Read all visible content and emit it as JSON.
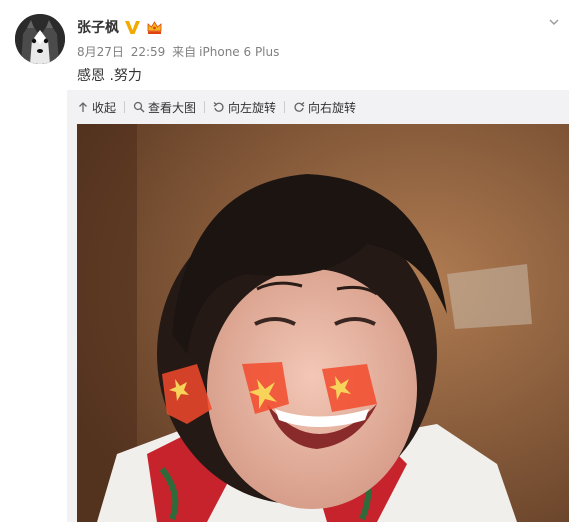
{
  "author": {
    "name": "张子枫"
  },
  "meta": {
    "date": "8月27日",
    "time": "22:59",
    "source_prefix": "来自",
    "source": "iPhone 6 Plus"
  },
  "post": {
    "text": "感恩 .努力"
  },
  "toolbar": {
    "collapse_label": "收起",
    "view_large_label": "查看大图",
    "rotate_left_label": "向左旋转",
    "rotate_right_label": "向右旋转"
  },
  "colors": {
    "accent_verified": "#f2a900",
    "member_badge": "#f6b622",
    "toolbar_icon": "#666666"
  },
  "icons": {
    "verified": "verified-v-icon",
    "member": "crown-icon",
    "expand": "chevron-down-icon",
    "collapse": "collapse-arrow-up-icon",
    "view_large": "magnifier-icon",
    "rotate_left": "rotate-left-icon",
    "rotate_right": "rotate-right-icon"
  }
}
